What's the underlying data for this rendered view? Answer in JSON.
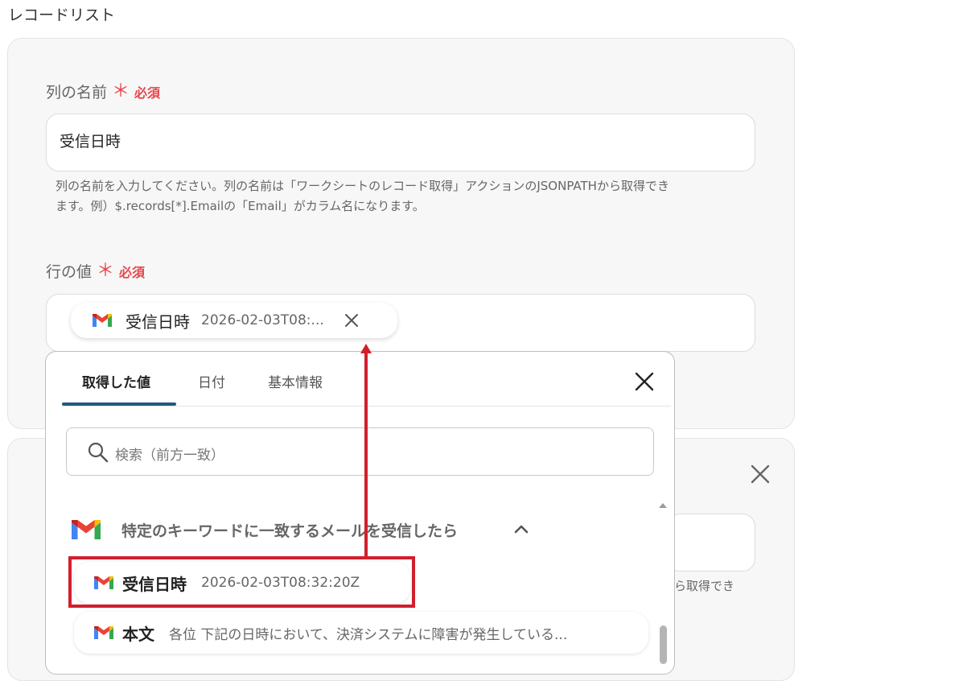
{
  "section_title": "レコードリスト",
  "card1": {
    "column_name": {
      "label": "列の名前",
      "required_star": "＊",
      "required_text": "必須",
      "value": "受信日時",
      "help_line1": "列の名前を入力してください。列の名前は「ワークシートのレコード取得」アクションのJSONPATHから取得でき",
      "help_line2": "ます。例）$.records[*].Emailの「Email」がカラム名になります。"
    },
    "row_value": {
      "label": "行の値",
      "required_star": "＊",
      "required_text": "必須",
      "chip": {
        "key": "受信日時",
        "value": "2026-02-03T08:..."
      }
    }
  },
  "card2": {
    "help_fragment": "ら取得でき"
  },
  "dropdown": {
    "tabs": [
      {
        "label": "取得した値"
      },
      {
        "label": "日付"
      },
      {
        "label": "基本情報"
      }
    ],
    "search_placeholder": "検索（前方一致）",
    "group_title": "特定のキーワードに一致するメールを受信したら",
    "items": [
      {
        "key": "受信日時",
        "value": "2026-02-03T08:32:20Z"
      },
      {
        "key": "本文",
        "value": "各位 下記の日時において、決済システムに障害が発生している..."
      }
    ]
  },
  "icons": {
    "service": "gmail-icon",
    "close": "close-icon",
    "search": "search-icon",
    "collapse": "chevron-up-icon"
  },
  "colors": {
    "required": "#e5484d",
    "active_tab": "#1f5c7a",
    "highlight": "#d21f2d"
  }
}
